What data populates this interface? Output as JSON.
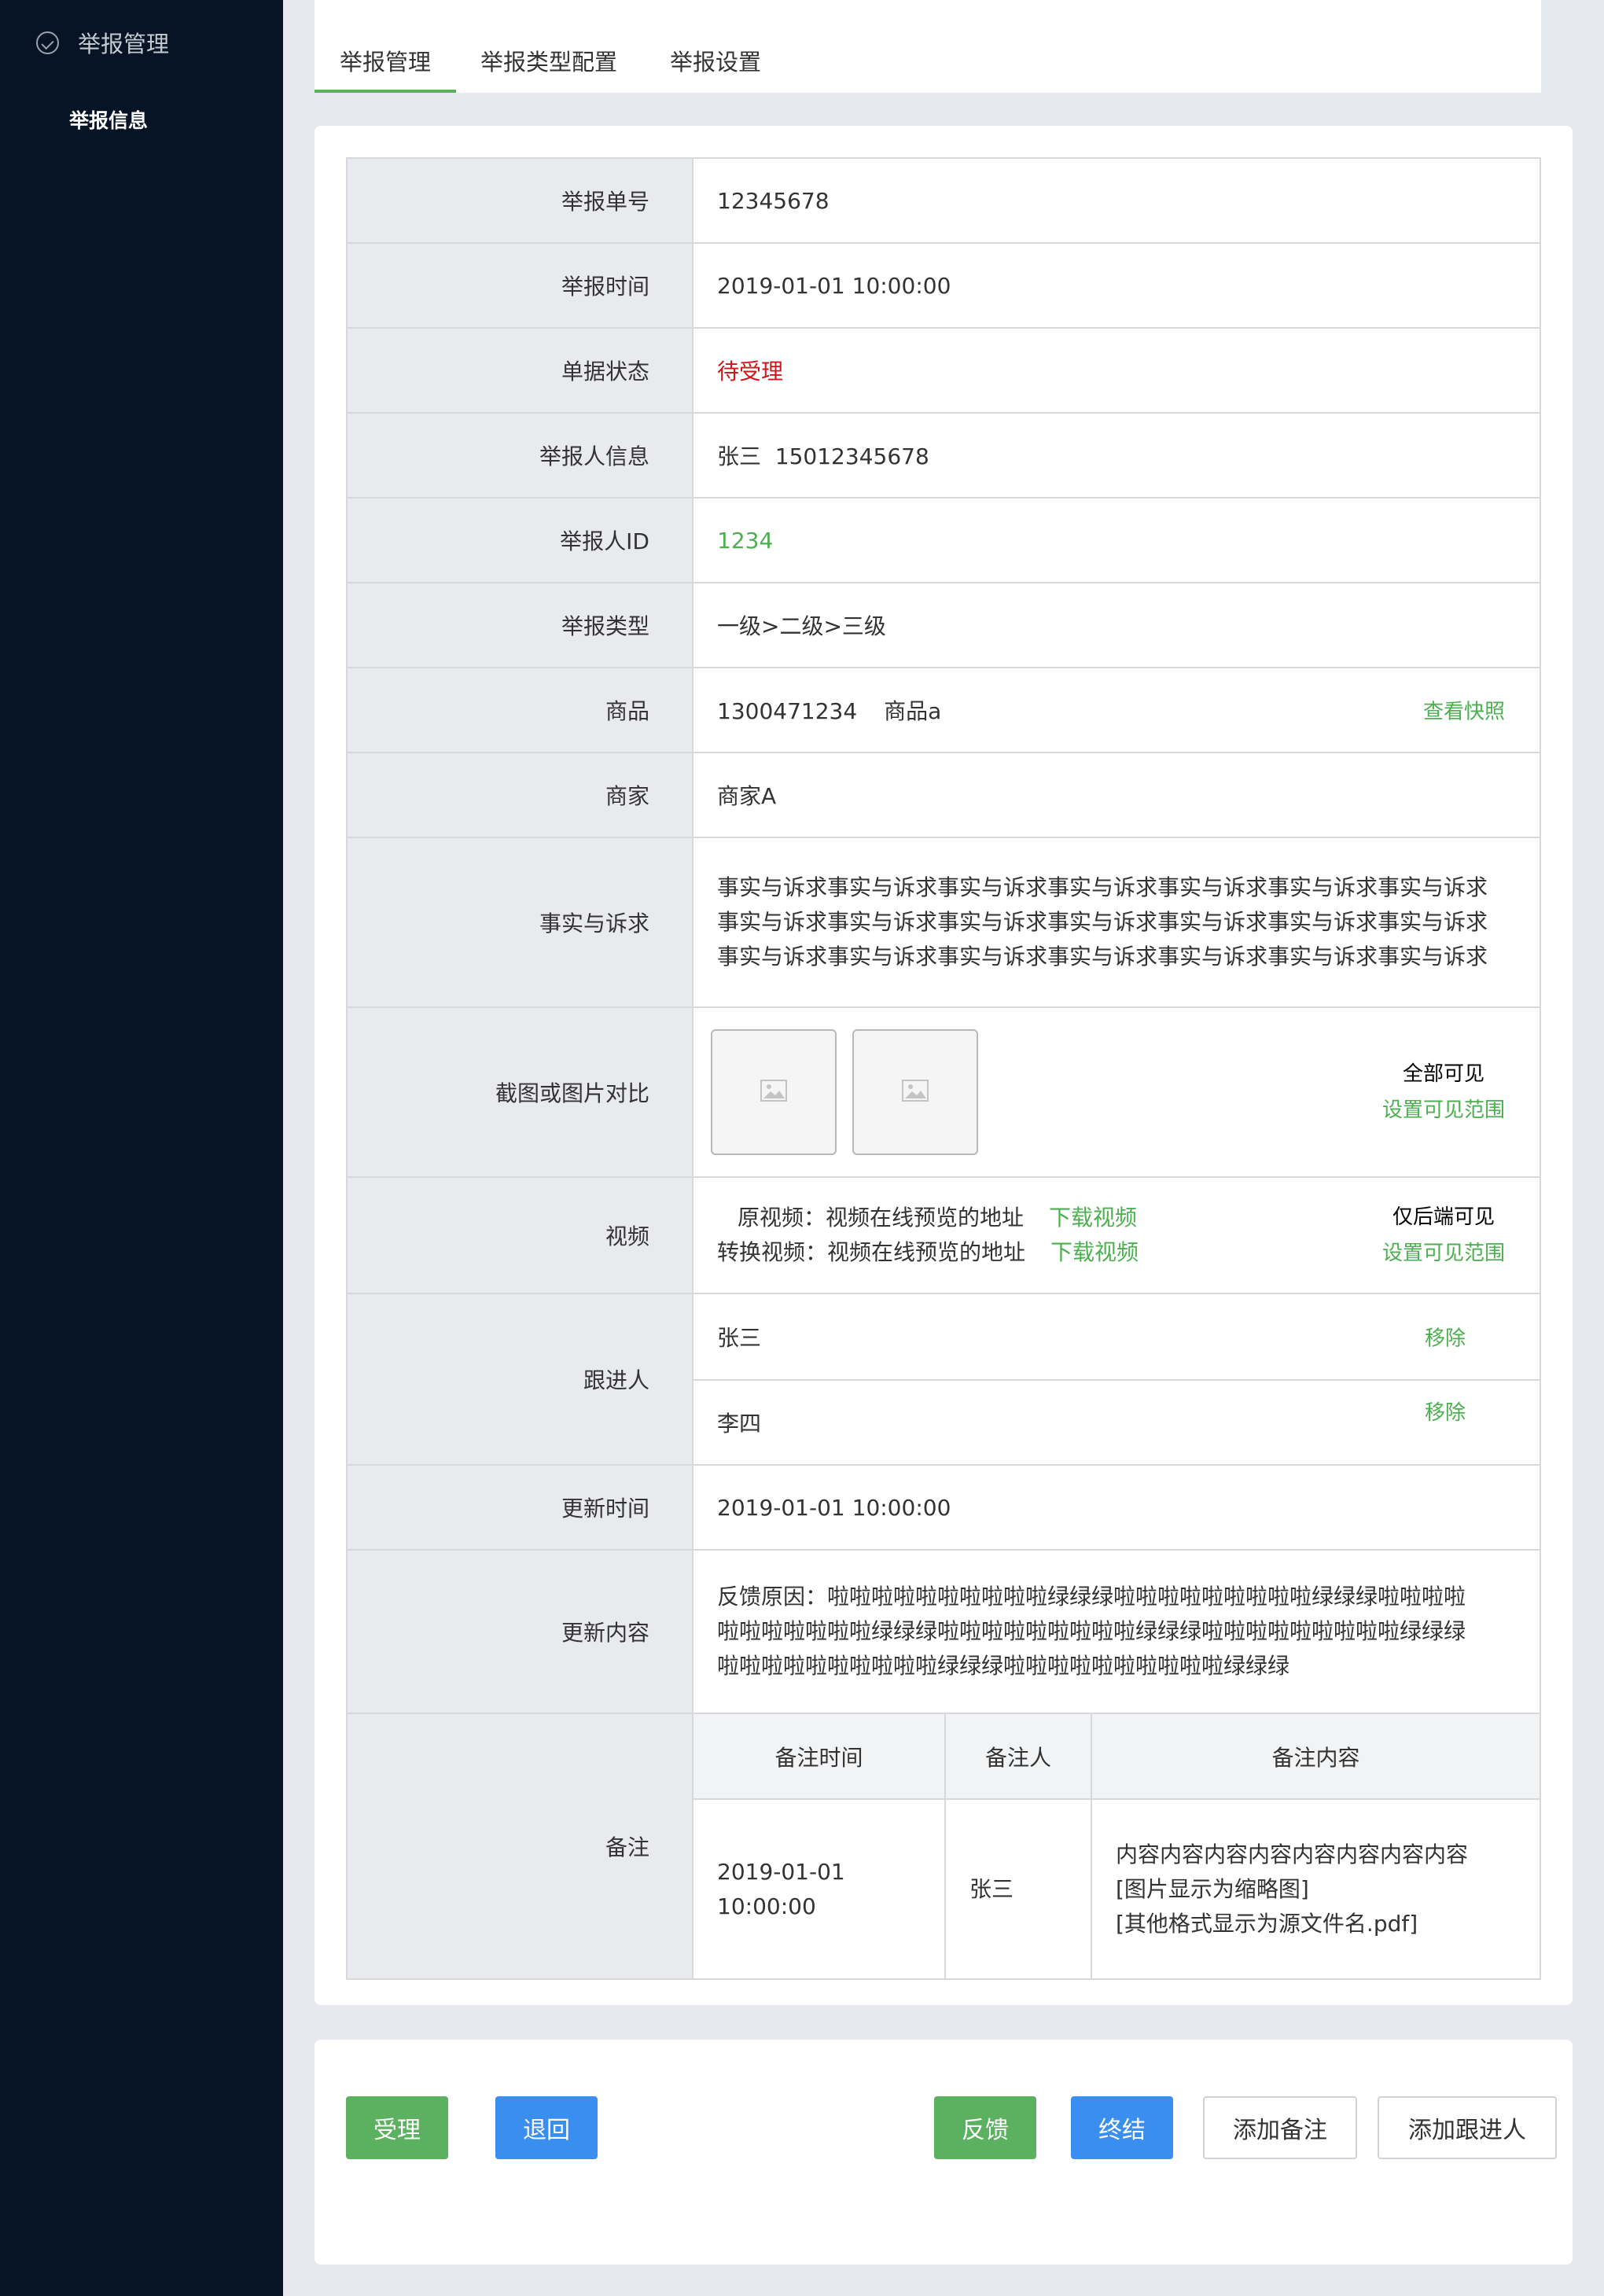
{
  "sidebar": {
    "group_label": "举报管理",
    "items": [
      {
        "label": "举报信息"
      }
    ]
  },
  "tabs": [
    {
      "label": "举报管理",
      "active": true
    },
    {
      "label": "举报类型配置",
      "active": false
    },
    {
      "label": "举报设置",
      "active": false
    }
  ],
  "report": {
    "id_label": "举报单号",
    "id_value": "12345678",
    "time_label": "举报时间",
    "time_value": "2019-01-01 10:00:00",
    "status_label": "单据状态",
    "status_value": "待受理",
    "reporter_label": "举报人信息",
    "reporter_value": "张三  15012345678",
    "reporter_id_label": "举报人ID",
    "reporter_id_value": "1234",
    "type_label": "举报类型",
    "type_value": "一级>二级>三级",
    "product_label": "商品",
    "product_code": "1300471234",
    "product_name": "商品a",
    "product_link": "查看快照",
    "merchant_label": "商家",
    "merchant_value": "商家A",
    "facts_label": "事实与诉求",
    "facts_lines": [
      "事实与诉求事实与诉求事实与诉求事实与诉求事实与诉求事实与诉求事实与诉求",
      "事实与诉求事实与诉求事实与诉求事实与诉求事实与诉求事实与诉求事实与诉求",
      "事实与诉求事实与诉求事实与诉求事实与诉求事实与诉求事实与诉求事实与诉求"
    ],
    "screenshot_label": "截图或图片对比",
    "screenshot_visibility": "全部可见",
    "screenshot_set_scope": "设置可见范围",
    "video_label": "视频",
    "video_original": "原视频：视频在线预览的地址",
    "video_original_download": "下载视频",
    "video_converted": "转换视频：视频在线预览的地址",
    "video_converted_download": "下载视频",
    "video_visibility": "仅后端可见",
    "video_set_scope": "设置可见范围",
    "follower_label": "跟进人",
    "followers": [
      {
        "name": "张三",
        "action": "移除"
      },
      {
        "name": "李四",
        "action": "移除"
      }
    ],
    "update_time_label": "更新时间",
    "update_time_value": "2019-01-01 10:00:00",
    "update_content_label": "更新内容",
    "update_content_lines": [
      "反馈原因：啦啦啦啦啦啦啦啦啦啦绿绿绿啦啦啦啦啦啦啦啦啦绿绿绿啦啦啦啦",
      "啦啦啦啦啦啦啦绿绿绿啦啦啦啦啦啦啦啦啦绿绿绿啦啦啦啦啦啦啦啦啦绿绿绿",
      "啦啦啦啦啦啦啦啦啦啦绿绿绿啦啦啦啦啦啦啦啦啦啦绿绿绿"
    ],
    "notes_label": "备注",
    "notes_headers": [
      "备注时间",
      "备注人",
      "备注内容"
    ],
    "note_time_line1": "2019-01-01",
    "note_time_line2": "10:00:00",
    "note_person": "张三",
    "note_content_lines": [
      "内容内容内容内容内容内容内容内容",
      "[图片显示为缩略图]",
      "[其他格式显示为源文件名.pdf]"
    ]
  },
  "actions": {
    "accept": "受理",
    "return": "退回",
    "feedback": "反馈",
    "close": "终结",
    "add_note": "添加备注",
    "add_follower": "添加跟进人"
  },
  "colors": {
    "sidebar_bg": "#061425",
    "accent_green": "#5bb15f",
    "accent_blue": "#3a8eef",
    "status_red": "#d4141b"
  },
  "icons": {
    "sidebar_group": "check-circle-icon",
    "thumbnail": "image-placeholder-icon"
  }
}
